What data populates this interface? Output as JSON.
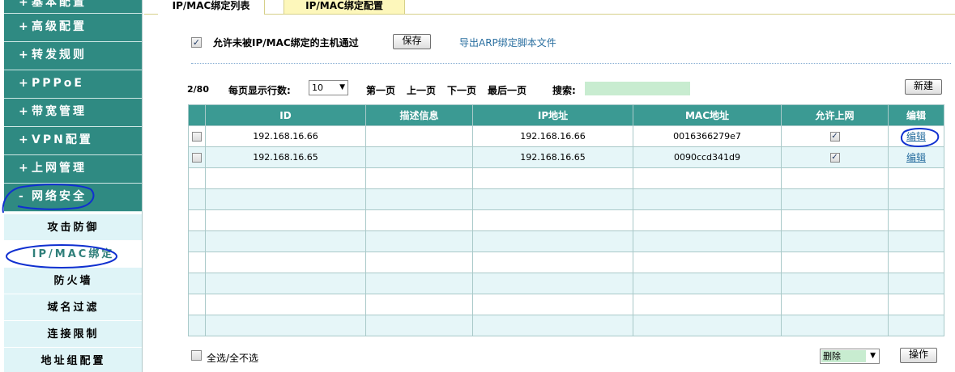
{
  "sidebar": {
    "items": [
      {
        "prefix": "+",
        "label": "基本配置"
      },
      {
        "prefix": "+",
        "label": "高级配置"
      },
      {
        "prefix": "+",
        "label": "转发规则"
      },
      {
        "prefix": "+",
        "label": "PPPoE"
      },
      {
        "prefix": "+",
        "label": "带宽管理"
      },
      {
        "prefix": "+",
        "label": "VPN配置"
      },
      {
        "prefix": "+",
        "label": "上网管理"
      },
      {
        "prefix": "-",
        "label": "网络安全"
      }
    ],
    "sub_items": [
      {
        "label": "攻击防御"
      },
      {
        "label": "IP/MAC绑定"
      },
      {
        "label": "防火墙"
      },
      {
        "label": "域名过滤"
      },
      {
        "label": "连接限制"
      },
      {
        "label": "地址组配置"
      }
    ]
  },
  "tabs": [
    {
      "label": "IP/MAC绑定列表"
    },
    {
      "label": "IP/MAC绑定配置"
    }
  ],
  "options": {
    "allow_unbound_label": "允许未被IP/MAC绑定的主机通过",
    "allow_unbound_checked": "✓",
    "save_label": "保存",
    "export_label": "导出ARP绑定脚本文件"
  },
  "pager": {
    "count": "2/80",
    "rows_per_page_label": "每页显示行数:",
    "rows_per_page_value": "10",
    "first": "第一页",
    "prev": "上一页",
    "next": "下一页",
    "last": "最后一页",
    "search_label": "搜索:",
    "search_value": "",
    "new_label": "新建"
  },
  "table": {
    "headers": [
      "ID",
      "描述信息",
      "IP地址",
      "MAC地址",
      "允许上网",
      "编辑"
    ],
    "rows": [
      {
        "id": "192.168.16.66",
        "desc": "",
        "ip": "192.168.16.66",
        "mac": "0016366279e7",
        "allow": "✓",
        "edit": "编辑"
      },
      {
        "id": "192.168.16.65",
        "desc": "",
        "ip": "192.168.16.65",
        "mac": "0090ccd341d9",
        "allow": "✓",
        "edit": "编辑"
      }
    ],
    "empty_rows": 8
  },
  "footer": {
    "select_all_label": "全选/全不选",
    "action_value": "删除",
    "operate_label": "操作"
  },
  "colors": {
    "sidebar": "#2f8a82",
    "sub_nav": "#dff4f7",
    "table_header": "#3b9a93",
    "row_alt": "#e6f6f8",
    "link": "#2a6fa0",
    "annotation": "#1030d0"
  }
}
